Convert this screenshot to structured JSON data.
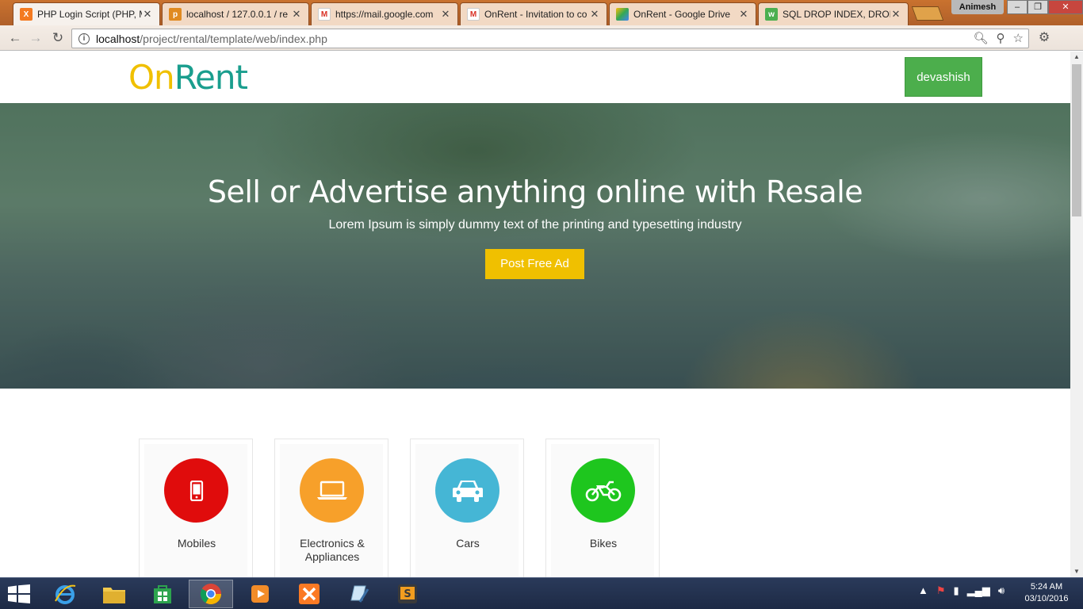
{
  "browser": {
    "tabs": [
      {
        "label": "PHP Login Script (PHP, M",
        "favicon": "xampp-icon",
        "color": "#f47a20"
      },
      {
        "label": "localhost / 127.0.0.1 / re",
        "favicon": "phpmyadmin-icon",
        "color": "#e08a20"
      },
      {
        "label": "https://mail.google.com",
        "favicon": "gmail-icon",
        "color": "#d93025"
      },
      {
        "label": "OnRent - Invitation to co",
        "favicon": "gmail-icon",
        "color": "#d93025"
      },
      {
        "label": "OnRent - Google Drive",
        "favicon": "drive-icon",
        "color": "#34a853"
      },
      {
        "label": "SQL DROP INDEX, DROP",
        "favicon": "w3schools-icon",
        "color": "#4caf50"
      }
    ],
    "user": "Animesh",
    "url_host": "localhost",
    "url_path": "/project/rental/template/web/index.php"
  },
  "site": {
    "logo_on": "On",
    "logo_rent": "Rent",
    "user_button": "devashish",
    "hero_title": "Sell or Advertise anything online with Resale",
    "hero_subtitle": "Lorem Ipsum is simply dummy text of the printing and typesetting industry",
    "hero_cta": "Post Free Ad"
  },
  "categories": [
    {
      "label": "Mobiles",
      "icon": "mobile-icon",
      "color": "#e00c0c"
    },
    {
      "label": "Electronics & Appliances",
      "icon": "laptop-icon",
      "color": "#f7a02a"
    },
    {
      "label": "Cars",
      "icon": "car-icon",
      "color": "#45b6d5"
    },
    {
      "label": "Bikes",
      "icon": "motorbike-icon",
      "color": "#1ec61e"
    }
  ],
  "taskbar": {
    "time": "5:24 AM",
    "date": "03/10/2016"
  },
  "colors": {
    "brand_yellow": "#f0c000",
    "brand_teal": "#1a9e8e",
    "user_green": "#4cae4c"
  }
}
